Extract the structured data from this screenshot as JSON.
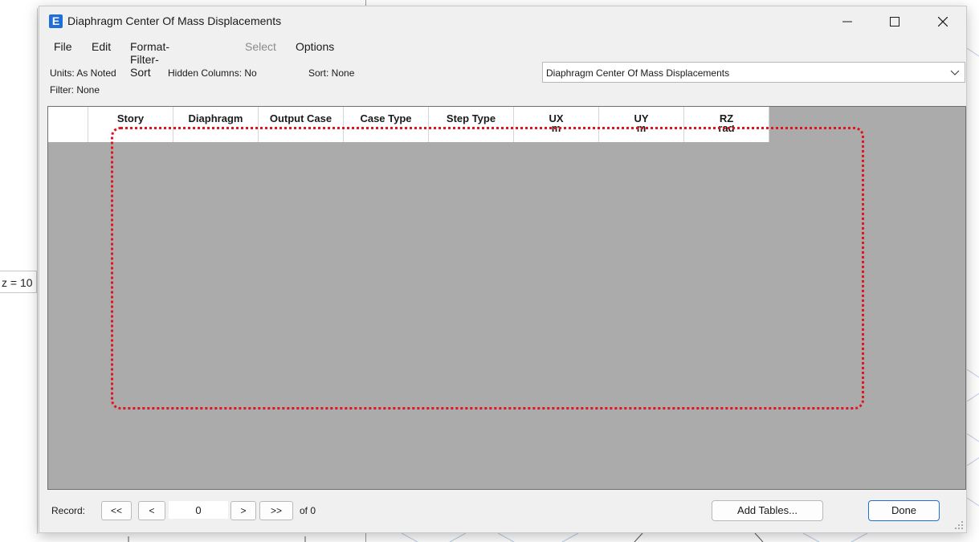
{
  "background": {
    "label": "z = 10"
  },
  "window": {
    "title": "Diaphragm Center Of Mass Displacements",
    "icon_letter": "E",
    "controls": [
      "minimize-icon",
      "maximize-icon",
      "close-icon"
    ]
  },
  "menu": {
    "file": "File",
    "edit": "Edit",
    "format": "Format-Filter-Sort",
    "select": "Select",
    "options": "Options"
  },
  "info": {
    "units": "Units:  As Noted",
    "hidden_columns": "Hidden Columns:  No",
    "sort": "Sort:  None",
    "filter": "Filter:  None"
  },
  "table_selector": {
    "value": "Diaphragm Center Of Mass Displacements"
  },
  "table": {
    "columns": [
      {
        "label": "Story",
        "unit": ""
      },
      {
        "label": "Diaphragm",
        "unit": ""
      },
      {
        "label": "Output Case",
        "unit": ""
      },
      {
        "label": "Case Type",
        "unit": ""
      },
      {
        "label": "Step Type",
        "unit": ""
      },
      {
        "label": "UX",
        "unit": "m"
      },
      {
        "label": "UY",
        "unit": "m"
      },
      {
        "label": "RZ",
        "unit": "rad"
      }
    ],
    "rows": []
  },
  "footer": {
    "record_label": "Record:",
    "first": "<<",
    "prev": "<",
    "record_value": "0",
    "next": ">",
    "last": ">>",
    "of": "of 0",
    "add_tables": "Add Tables...",
    "done": "Done"
  },
  "colors": {
    "accent": "#1f6fd6",
    "grid_background": "#ababab",
    "selection": "#e0141c"
  }
}
